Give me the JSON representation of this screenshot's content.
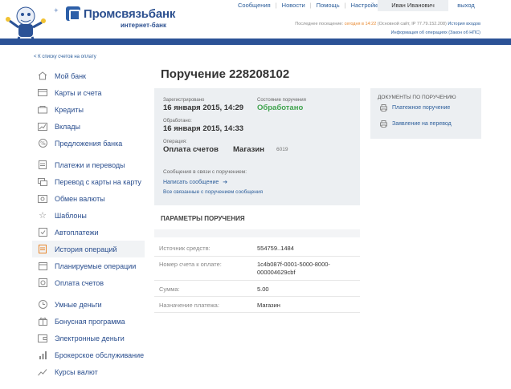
{
  "header": {
    "logo_text": "Промсвязьбанк",
    "logo_sub": "интернет-банк",
    "nav": [
      "Сообщения",
      "Новости",
      "Помощь",
      "Настройки"
    ],
    "user_name": "Иван Иванович",
    "logout": "выход",
    "last_visit_label": "Последнее посещение:",
    "last_visit_time": "сегодня в 14:22",
    "last_visit_detail": "(Основной сайт, IP 77.79.152.208)",
    "login_history": "История входов",
    "op_info": "Информация об операциях (Закон об НПС)"
  },
  "back_link": "< К списку счетов на оплату",
  "sidebar": {
    "group1": [
      {
        "label": "Мой банк",
        "icon": "home-icon"
      },
      {
        "label": "Карты и счета",
        "icon": "card-icon"
      },
      {
        "label": "Кредиты",
        "icon": "credit-icon"
      },
      {
        "label": "Вклады",
        "icon": "chart-icon"
      },
      {
        "label": "Предложения банка",
        "icon": "percent-icon"
      }
    ],
    "group2": [
      {
        "label": "Платежи и переводы",
        "icon": "doc-icon"
      },
      {
        "label": "Перевод с карты на карту",
        "icon": "card-transfer-icon"
      },
      {
        "label": "Обмен валюты",
        "icon": "exchange-icon"
      },
      {
        "label": "Шаблоны",
        "icon": "star-icon"
      },
      {
        "label": "Автоплатежи",
        "icon": "auto-icon"
      },
      {
        "label": "История операций",
        "icon": "history-icon",
        "active": true
      },
      {
        "label": "Планируемые операции",
        "icon": "calendar-icon"
      },
      {
        "label": "Оплата счетов",
        "icon": "bill-icon"
      }
    ],
    "group3": [
      {
        "label": "Умные деньги",
        "icon": "clock-icon"
      },
      {
        "label": "Бонусная программа",
        "icon": "gift-icon"
      },
      {
        "label": "Электронные деньги",
        "icon": "wallet-icon"
      },
      {
        "label": "Брокерское обслуживание",
        "icon": "bars-icon"
      },
      {
        "label": "Курсы валют",
        "icon": "trend-icon"
      }
    ]
  },
  "main": {
    "title": "Поручение 228208102",
    "registered_label": "Зарегистрировано",
    "registered_value": "16 января 2015, 14:29",
    "status_label": "Состояние поручения",
    "status_value": "Обработано",
    "processed_label": "Обработано:",
    "processed_value": "16 января 2015, 14:33",
    "operation_label": "Операция:",
    "operation_value": "Оплата счетов",
    "operation_merchant": "Магазин",
    "operation_code": "6019",
    "messages_label": "Сообщения в связи с поручением:",
    "write_message": "Написать сообщение",
    "all_messages": "Все связанные с поручением сообщения",
    "params_title": "ПАРАМЕТРЫ ПОРУЧЕНИЯ",
    "params": [
      {
        "key": "Источник средств:",
        "value": "554759..1484"
      },
      {
        "key": "Номер счета к оплате:",
        "value": "1c4b087f-0001-5000-8000-000004629cbf"
      },
      {
        "key": "Сумма:",
        "value": "5.00"
      },
      {
        "key": "Назначение платежа:",
        "value": "Магазин"
      }
    ]
  },
  "docs": {
    "title": "ДОКУМЕНТЫ ПО ПОРУЧЕНИЮ",
    "items": [
      "Платежное поручение",
      "Заявление на перевод"
    ]
  },
  "colors": {
    "brand_blue": "#2b5296",
    "link_blue": "#2b5d9a",
    "status_green": "#3fa34d",
    "accent_orange": "#e8862c"
  }
}
